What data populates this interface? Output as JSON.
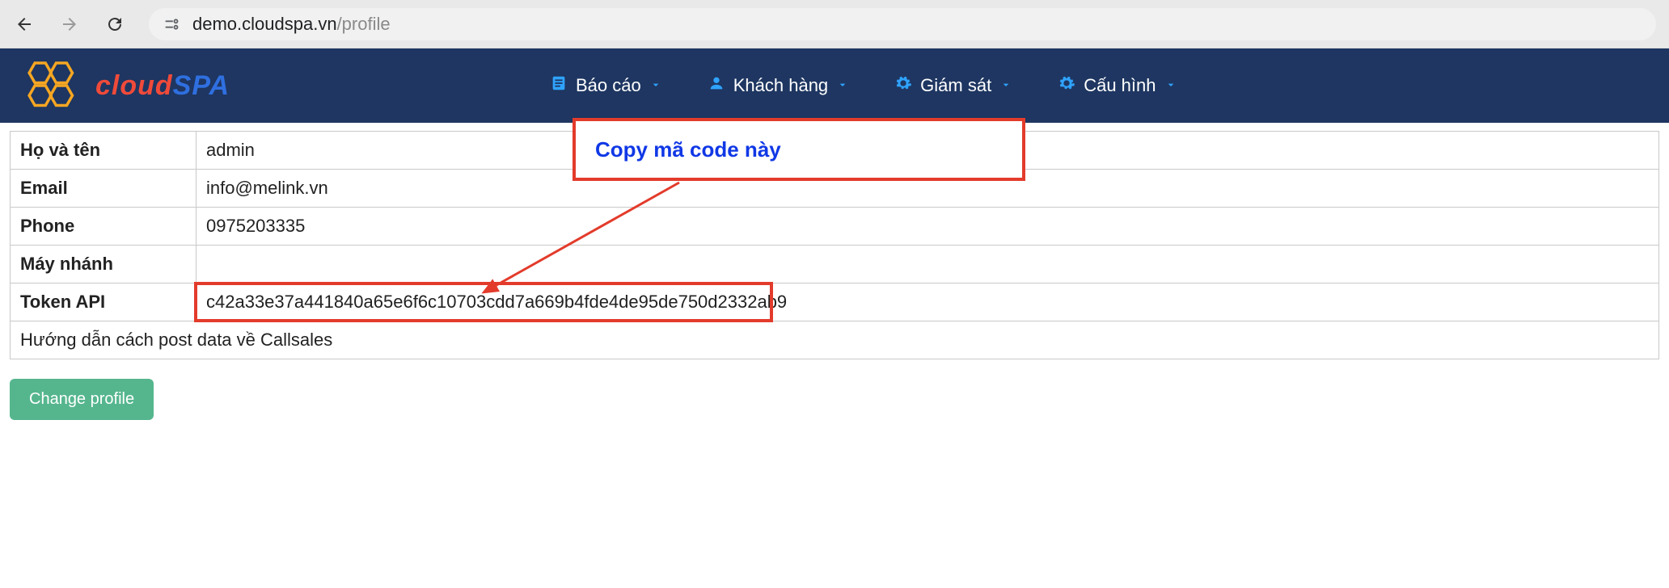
{
  "browser": {
    "url_host": "demo.cloudspa.vn",
    "url_path": "/profile"
  },
  "logo": {
    "cloud": "cloud",
    "spa": "SPA"
  },
  "nav": {
    "items": [
      {
        "label": "Báo cáo",
        "icon": "report-icon"
      },
      {
        "label": "Khách hàng",
        "icon": "user-icon"
      },
      {
        "label": "Giám sát",
        "icon": "gear-icon"
      },
      {
        "label": "Cấu hình",
        "icon": "gear-icon"
      }
    ]
  },
  "profile": {
    "rows": [
      {
        "label": "Họ và tên",
        "value": "admin"
      },
      {
        "label": "Email",
        "value": "info@melink.vn"
      },
      {
        "label": "Phone",
        "value": "0975203335"
      },
      {
        "label": "Máy nhánh",
        "value": ""
      },
      {
        "label": "Token API",
        "value": "c42a33e37a441840a65e6f6c10703cdd7a669b4fde4de95de750d2332ab9"
      }
    ],
    "footer": "Hướng dẫn cách post data về Callsales",
    "change_btn": "Change profile"
  },
  "annotation": {
    "copy_code": "Copy mã code này"
  }
}
